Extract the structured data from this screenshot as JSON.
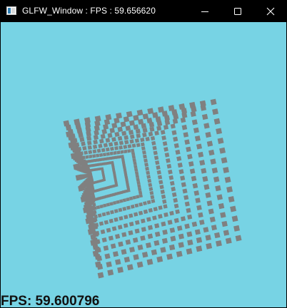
{
  "window": {
    "title": "GLFW_Window : FPS : 59.656620",
    "controls": {
      "minimize_icon": "minimize-icon",
      "maximize_icon": "maximize-icon",
      "close_icon": "close-icon"
    }
  },
  "scene": {
    "background_color": "#77d3e4",
    "geometry_color": "#808080"
  },
  "overlay": {
    "fps_text": "FPS: 59.600796"
  }
}
